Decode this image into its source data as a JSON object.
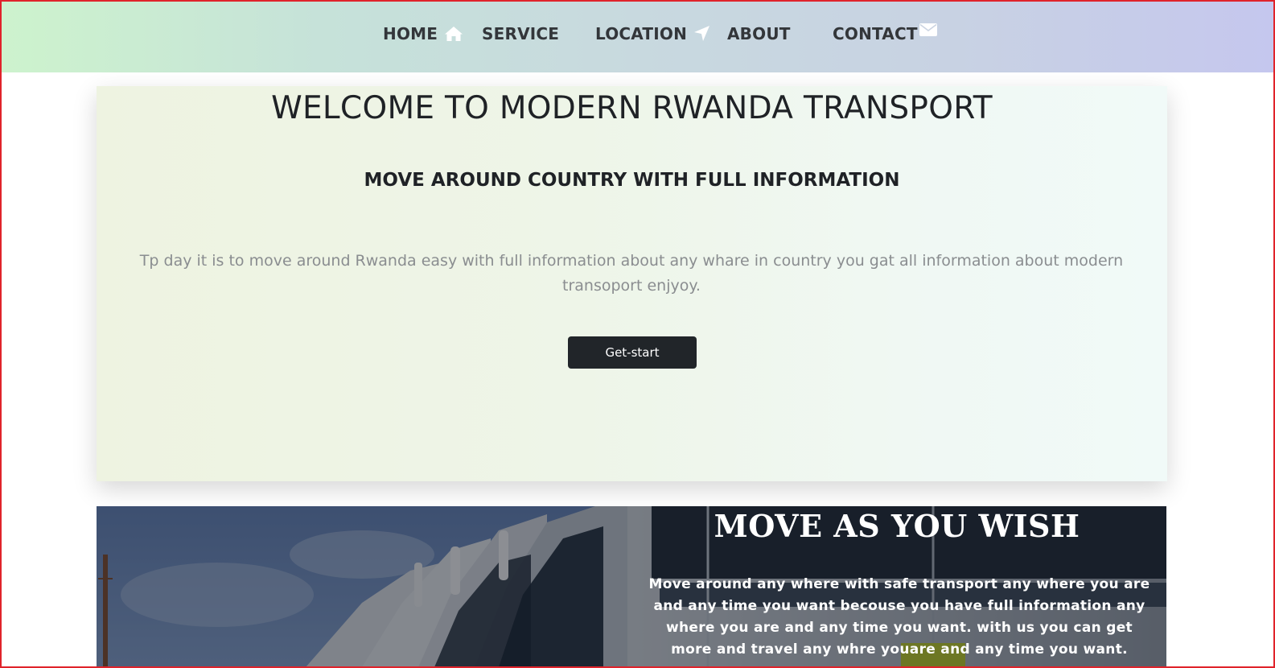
{
  "nav": {
    "items": [
      {
        "label": "HOME",
        "icon": "home-icon"
      },
      {
        "label": "SERVICE"
      },
      {
        "label": "LOCATION",
        "icon": "location-arrow-icon"
      },
      {
        "label": "ABOUT"
      },
      {
        "label": "CONTACT",
        "icon": "envelope-icon"
      }
    ]
  },
  "hero": {
    "title": "WELCOME TO MODERN RWANDA TRANSPORT",
    "subtitle": "MOVE AROUND COUNTRY WITH FULL INFORMATION",
    "text": "Tp day it is to move around Rwanda easy with full information about any whare in country you gat all information about modern transoport enjyoy.",
    "button_label": "Get-start"
  },
  "promo": {
    "title": "MOVE AS YOU WISH",
    "text": "Move around any where with safe transport any where you are and any time you want becouse you have full information any where you are and any time you want. with us you can get more and travel any whre youare and any time you want."
  },
  "colors": {
    "frame_border": "#e0232b",
    "button_bg": "#212529",
    "nav_gradient_start": "#cdf3cd",
    "nav_gradient_end": "#c5c7ee"
  }
}
